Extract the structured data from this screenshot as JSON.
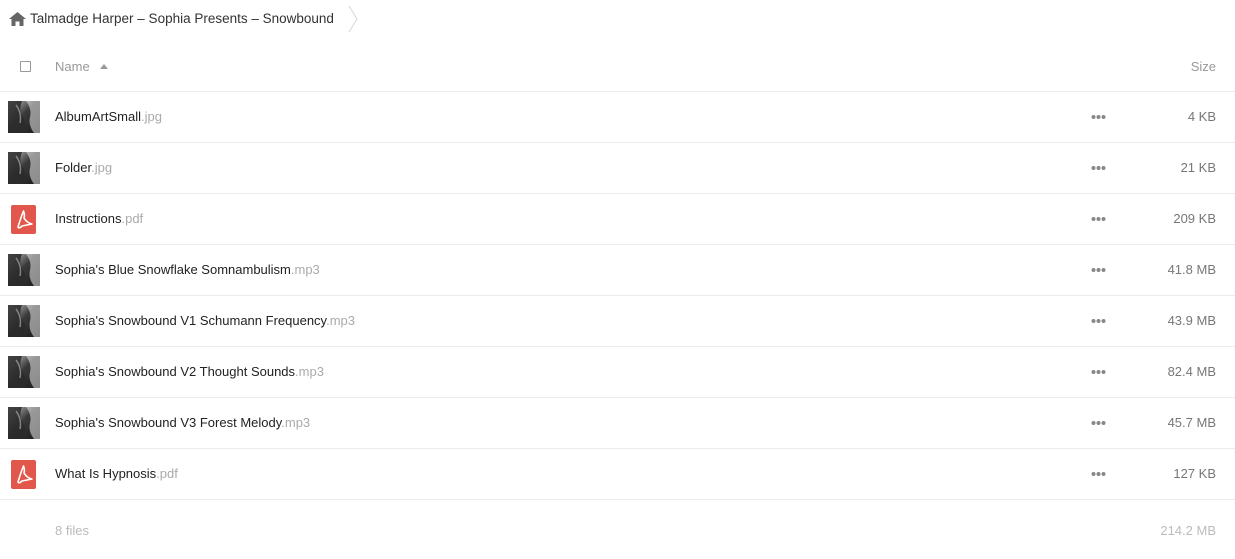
{
  "breadcrumb": {
    "path_label": "Talmadge Harper – Sophia Presents – Snowbound",
    "home_icon": "home-icon",
    "separator_icon": "chevron-right-icon"
  },
  "header": {
    "name_label": "Name",
    "size_label": "Size",
    "sort_icon": "sort-ascending-icon"
  },
  "files": [
    {
      "name": "AlbumArtSmall",
      "ext": ".jpg",
      "size": "4 KB",
      "kind": "image"
    },
    {
      "name": "Folder",
      "ext": ".jpg",
      "size": "21 KB",
      "kind": "image"
    },
    {
      "name": "Instructions",
      "ext": ".pdf",
      "size": "209 KB",
      "kind": "pdf"
    },
    {
      "name": "Sophia's Blue Snowflake Somnambulism",
      "ext": ".mp3",
      "size": "41.8 MB",
      "kind": "image"
    },
    {
      "name": "Sophia's Snowbound V1 Schumann Frequency",
      "ext": ".mp3",
      "size": "43.9 MB",
      "kind": "image"
    },
    {
      "name": "Sophia's Snowbound V2 Thought Sounds",
      "ext": ".mp3",
      "size": "82.4 MB",
      "kind": "image"
    },
    {
      "name": "Sophia's Snowbound V3 Forest Melody",
      "ext": ".mp3",
      "size": "45.7 MB",
      "kind": "image"
    },
    {
      "name": "What Is Hypnosis",
      "ext": ".pdf",
      "size": "127 KB",
      "kind": "pdf"
    }
  ],
  "summary": {
    "count": "8 files",
    "total_size": "214.2 MB"
  },
  "colors": {
    "pdf_red": "#e2574c",
    "row_border": "#ebebeb",
    "muted_text": "#999999"
  }
}
